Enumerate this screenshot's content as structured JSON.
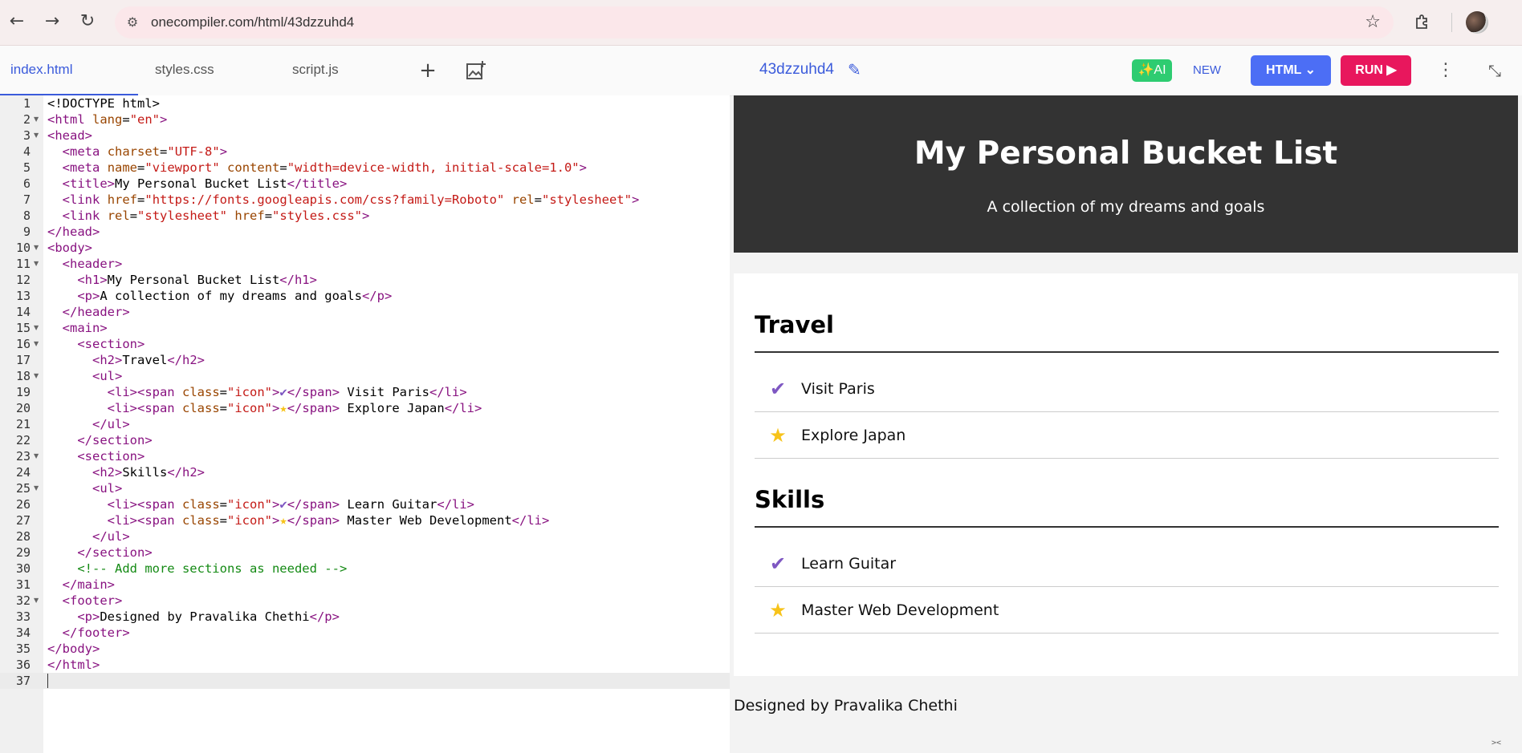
{
  "browser": {
    "url": "onecompiler.com/html/43dzzuhd4",
    "back_icon": "←",
    "forward_icon": "→",
    "reload_icon": "↻",
    "site_icon": "⚙",
    "star_icon": "☆"
  },
  "ide": {
    "tabs": [
      "index.html",
      "styles.css",
      "script.js"
    ],
    "add_icon": "+",
    "image_icon": "🖼",
    "project_name": "43dzzuhd4",
    "edit_icon": "✎",
    "ai_label": "✨AI",
    "new_label": "NEW",
    "language_label": "HTML ⌄",
    "run_label": "RUN ▶",
    "more_icon": "⋮",
    "collapse_icon": "⤡"
  },
  "editor": {
    "line_numbers": [
      "1",
      "2",
      "3",
      "4",
      "5",
      "6",
      "7",
      "8",
      "9",
      "10",
      "11",
      "12",
      "13",
      "14",
      "15",
      "16",
      "17",
      "18",
      "19",
      "20",
      "21",
      "22",
      "23",
      "24",
      "25",
      "26",
      "27",
      "28",
      "29",
      "30",
      "31",
      "32",
      "33",
      "34",
      "35",
      "36",
      "37"
    ]
  },
  "preview": {
    "title": "My Personal Bucket List",
    "subtitle": "A collection of my dreams and goals",
    "sections": [
      {
        "heading": "Travel",
        "items": [
          {
            "icon": "✔",
            "text": "Visit Paris"
          },
          {
            "icon": "★",
            "text": "Explore Japan"
          }
        ]
      },
      {
        "heading": "Skills",
        "items": [
          {
            "icon": "✔",
            "text": "Learn Guitar"
          },
          {
            "icon": "★",
            "text": "Master Web Development"
          }
        ]
      }
    ],
    "footer": "Designed by Pravalika Chethi",
    "resize_handle": "><"
  },
  "colors": {
    "accent": "#3b5bdb",
    "ai_green": "#2ecc71",
    "run_pink": "#e8175d",
    "html_blue": "#4c6ef5",
    "check_purple": "#7e57c2",
    "star_yellow": "#f7c31a"
  }
}
